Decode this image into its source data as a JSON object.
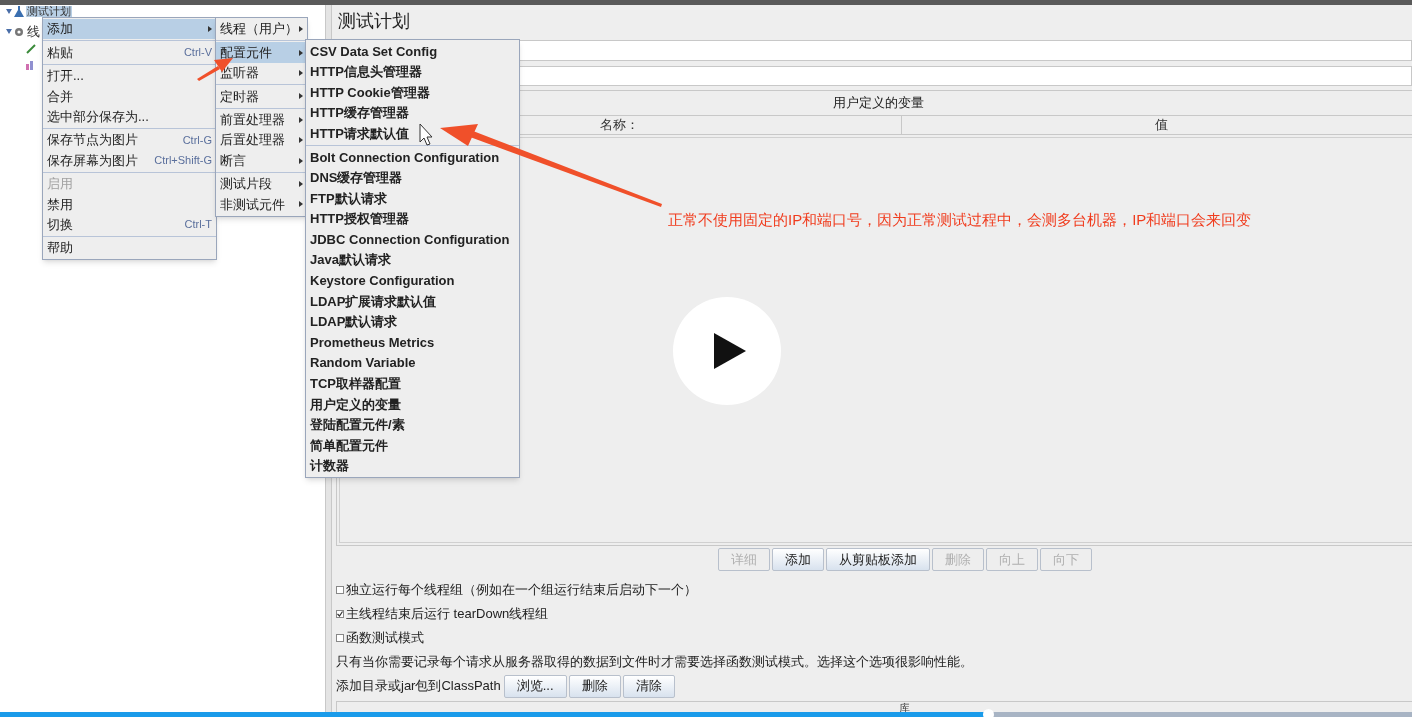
{
  "tree": [
    {
      "label": "测试计划",
      "selected": true
    },
    {
      "label": "线",
      "selected": false
    }
  ],
  "context_menu": [
    {
      "kind": "item",
      "label": "添加",
      "selected": true,
      "disabled": false,
      "submenu": true
    },
    {
      "kind": "separator"
    },
    {
      "kind": "item",
      "label": "粘贴",
      "shortcut": "Ctrl-V",
      "selected": false,
      "disabled": false,
      "submenu": false
    },
    {
      "kind": "separator"
    },
    {
      "kind": "item",
      "label": "打开...",
      "selected": false,
      "disabled": false,
      "submenu": false
    },
    {
      "kind": "item",
      "label": "合并",
      "selected": false,
      "disabled": false,
      "submenu": false
    },
    {
      "kind": "item",
      "label": "选中部分保存为...",
      "selected": false,
      "disabled": false,
      "submenu": false
    },
    {
      "kind": "separator"
    },
    {
      "kind": "item",
      "label": "保存节点为图片",
      "shortcut": "Ctrl-G",
      "selected": false,
      "disabled": false,
      "submenu": false
    },
    {
      "kind": "item",
      "label": "保存屏幕为图片",
      "shortcut": "Ctrl+Shift-G",
      "selected": false,
      "disabled": false,
      "submenu": false
    },
    {
      "kind": "separator"
    },
    {
      "kind": "item",
      "label": "启用",
      "selected": false,
      "disabled": true,
      "submenu": false
    },
    {
      "kind": "item",
      "label": "禁用",
      "selected": false,
      "disabled": false,
      "submenu": false
    },
    {
      "kind": "item",
      "label": "切换",
      "shortcut": "Ctrl-T",
      "selected": false,
      "disabled": false,
      "submenu": false
    },
    {
      "kind": "separator"
    },
    {
      "kind": "item",
      "label": "帮助",
      "selected": false,
      "disabled": false,
      "submenu": false
    }
  ],
  "add_submenu": [
    {
      "kind": "item",
      "label": "线程（用户）",
      "selected": false,
      "submenu": true
    },
    {
      "kind": "separator"
    },
    {
      "kind": "item",
      "label": "配置元件",
      "selected": true,
      "submenu": true
    },
    {
      "kind": "item",
      "label": "监听器",
      "selected": false,
      "submenu": true
    },
    {
      "kind": "separator"
    },
    {
      "kind": "item",
      "label": "定时器",
      "selected": false,
      "submenu": true
    },
    {
      "kind": "separator"
    },
    {
      "kind": "item",
      "label": "前置处理器",
      "selected": false,
      "submenu": true
    },
    {
      "kind": "item",
      "label": "后置处理器",
      "selected": false,
      "submenu": true
    },
    {
      "kind": "item",
      "label": "断言",
      "selected": false,
      "submenu": true
    },
    {
      "kind": "separator"
    },
    {
      "kind": "item",
      "label": "测试片段",
      "selected": false,
      "submenu": true
    },
    {
      "kind": "item",
      "label": "非测试元件",
      "selected": false,
      "submenu": true
    }
  ],
  "config_submenu": [
    {
      "kind": "item",
      "label": "CSV Data Set Config",
      "selected": false
    },
    {
      "kind": "item",
      "label": "HTTP信息头管理器",
      "selected": false
    },
    {
      "kind": "item",
      "label": "HTTP Cookie管理器",
      "selected": false
    },
    {
      "kind": "item",
      "label": "HTTP缓存管理器",
      "selected": false
    },
    {
      "kind": "item",
      "label": "HTTP请求默认值",
      "selected": false
    },
    {
      "kind": "separator"
    },
    {
      "kind": "item",
      "label": "Bolt Connection Configuration",
      "selected": false
    },
    {
      "kind": "item",
      "label": "DNS缓存管理器",
      "selected": false
    },
    {
      "kind": "item",
      "label": "FTP默认请求",
      "selected": false
    },
    {
      "kind": "item",
      "label": "HTTP授权管理器",
      "selected": false
    },
    {
      "kind": "item",
      "label": "JDBC Connection Configuration",
      "selected": false
    },
    {
      "kind": "item",
      "label": "Java默认请求",
      "selected": false
    },
    {
      "kind": "item",
      "label": "Keystore Configuration",
      "selected": false
    },
    {
      "kind": "item",
      "label": "LDAP扩展请求默认值",
      "selected": false
    },
    {
      "kind": "item",
      "label": "LDAP默认请求",
      "selected": false
    },
    {
      "kind": "item",
      "label": "Prometheus Metrics",
      "selected": false
    },
    {
      "kind": "item",
      "label": "Random Variable",
      "selected": false
    },
    {
      "kind": "item",
      "label": "TCP取样器配置",
      "selected": false
    },
    {
      "kind": "item",
      "label": "用户定义的变量",
      "selected": false
    },
    {
      "kind": "item",
      "label": "登陆配置元件/素",
      "selected": false
    },
    {
      "kind": "item",
      "label": "简单配置元件",
      "selected": false
    },
    {
      "kind": "item",
      "label": "计数器",
      "selected": false
    }
  ],
  "panel": {
    "title": "测试计划",
    "variables_table": {
      "title": "用户定义的变量",
      "columns": [
        "名称：",
        "值"
      ]
    },
    "table_buttons": [
      {
        "label": "详细",
        "disabled": true
      },
      {
        "label": "添加",
        "disabled": false
      },
      {
        "label": "从剪贴板添加",
        "disabled": false
      },
      {
        "label": "删除",
        "disabled": true
      },
      {
        "label": "向上",
        "disabled": true
      },
      {
        "label": "向下",
        "disabled": true
      }
    ],
    "options": [
      {
        "label": "独立运行每个线程组（例如在一个组运行结束后启动下一个）",
        "checked": false
      },
      {
        "label": "主线程结束后运行 tearDown线程组",
        "checked": true
      },
      {
        "label": "函数测试模式",
        "checked": false
      }
    ],
    "note": "只有当你需要记录每个请求从服务器取得的数据到文件时才需要选择函数测试模式。选择这个选项很影响性能。",
    "classpath": {
      "label": "添加目录或jar包到ClassPath",
      "buttons": [
        "浏览...",
        "删除",
        "清除"
      ]
    },
    "library_table": {
      "columns": [
        "库"
      ]
    }
  },
  "annotation": {
    "text": "正常不使用固定的IP和端口号，因为正常测试过程中，会测多台机器，IP和端口会来回变"
  },
  "video": {
    "level": 0.7
  }
}
